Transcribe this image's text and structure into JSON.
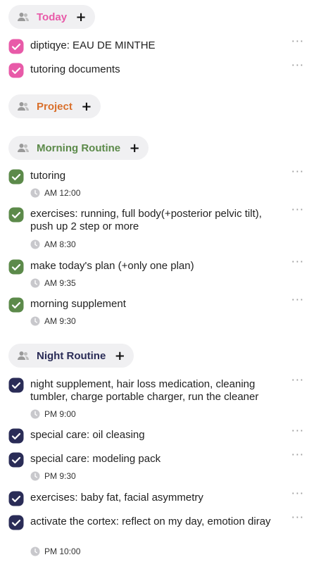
{
  "colors": {
    "today": "#e85aa8",
    "project": "#d9702c",
    "morning": "#5c8a4a",
    "night": "#2a2c57",
    "header_bg": "#f0f0f2",
    "muted": "#9a9a9a"
  },
  "icons": {
    "group": "people-icon",
    "add": "plus-icon",
    "check": "check-icon",
    "more": "more-icon",
    "time": "clock-icon"
  },
  "more_glyph": "···",
  "add_glyph": "+",
  "groups": {
    "today": {
      "title": "Today",
      "tasks": [
        {
          "text": "diptiqye: EAU DE MINTHE"
        },
        {
          "text": "tutoring documents"
        }
      ]
    },
    "project": {
      "title": "Project"
    },
    "morning": {
      "title": "Morning Routine",
      "tasks": [
        {
          "text": "tutoring",
          "time": "AM 12:00"
        },
        {
          "text": "exercises: running, full body(+posterior pelvic tilt), push up 2 step or more",
          "time": "AM 8:30"
        },
        {
          "text": "make today's plan (+only one plan)",
          "time": "AM 9:35"
        },
        {
          "text": "morning supplement",
          "time": "AM 9:30"
        }
      ]
    },
    "night": {
      "title": "Night Routine",
      "tasks": [
        {
          "text": "night supplement, hair loss medication, cleaning tumbler, charge portable charger, run the cleaner",
          "time": "PM 9:00"
        },
        {
          "text": "special care: oil cleasing"
        },
        {
          "text": "special care: modeling pack",
          "time": "PM 9:30"
        },
        {
          "text": "exercises: baby fat, facial asymmetry"
        },
        {
          "text": "activate the cortex: reflect on my day, emotion diray",
          "time": "PM 10:00"
        }
      ]
    }
  }
}
